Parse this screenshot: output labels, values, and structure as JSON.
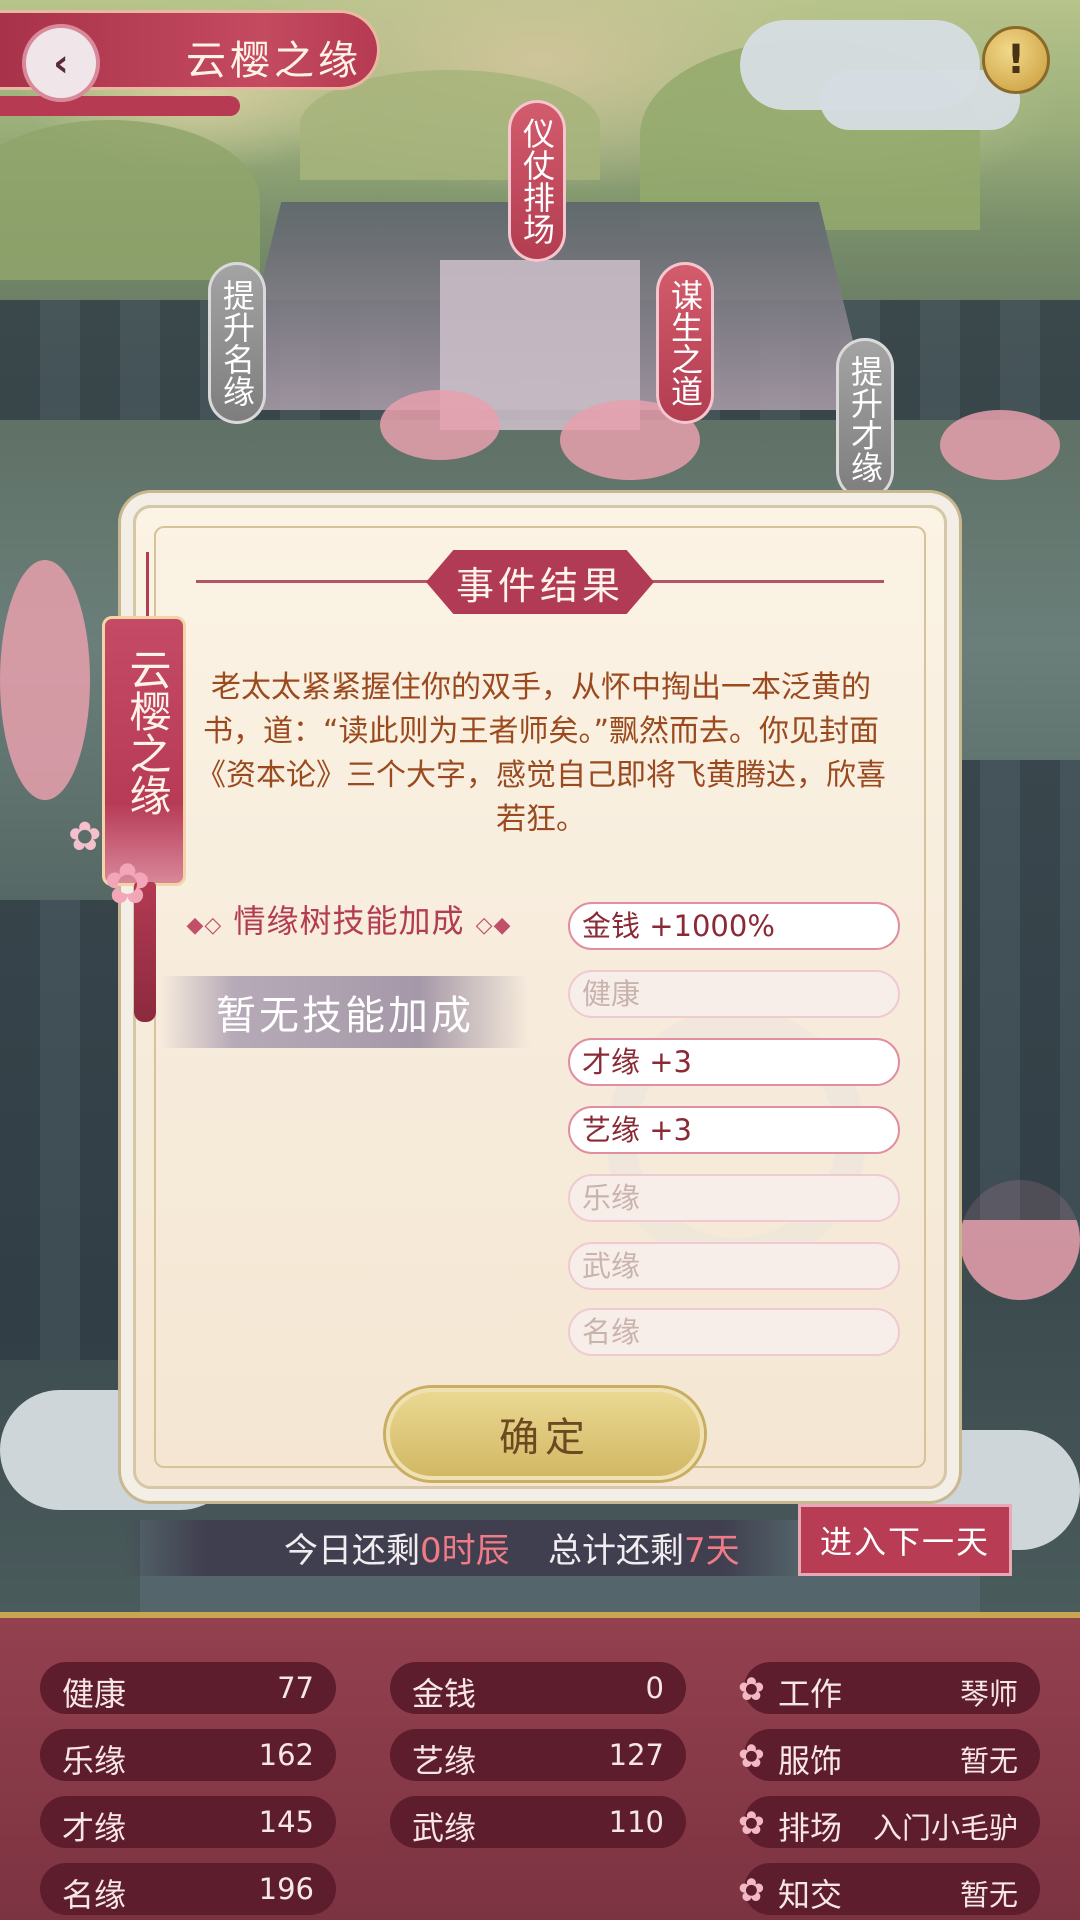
{
  "header": {
    "back_icon": "chevron-left-icon",
    "title": "云樱之缘",
    "info_icon": "exclamation-icon"
  },
  "map_tags": [
    {
      "label": "仪仗排场",
      "style": "red"
    },
    {
      "label": "提升名缘",
      "style": "grey"
    },
    {
      "label": "谋生之道",
      "style": "red"
    },
    {
      "label": "提升才缘",
      "style": "grey"
    }
  ],
  "dialog": {
    "title": "事件结果",
    "side_tag": "云樱之缘",
    "story": "老太太紧紧握住你的双手，从怀中掏出一本泛黄的书，道：“读此则为王者师矣。”飘然而去。你见封面《资本论》三个大字，感觉自己即将飞黄腾达，欣喜若狂。",
    "skill_title": "情缘树技能加成",
    "skill_value": "暂无技能加成",
    "rewards": [
      {
        "text": "金钱 +1000%",
        "active": true
      },
      {
        "text": "健康",
        "active": false
      },
      {
        "text": "才缘 +3",
        "active": true
      },
      {
        "text": "艺缘 +3",
        "active": true
      },
      {
        "text": "乐缘",
        "active": false
      },
      {
        "text": "武缘",
        "active": false
      },
      {
        "text": "名缘",
        "active": false
      }
    ],
    "confirm_label": "确定"
  },
  "day_bar": {
    "today_prefix": "今日还剩",
    "today_value": "0时辰",
    "total_prefix": "总计还剩",
    "total_value": "7天",
    "next_day_label": "进入下一天"
  },
  "stats": {
    "col1": [
      {
        "label": "健康",
        "value": "77"
      },
      {
        "label": "乐缘",
        "value": "162"
      },
      {
        "label": "才缘",
        "value": "145"
      },
      {
        "label": "名缘",
        "value": "196"
      }
    ],
    "col2": [
      {
        "label": "金钱",
        "value": "0"
      },
      {
        "label": "艺缘",
        "value": "127"
      },
      {
        "label": "武缘",
        "value": "110"
      }
    ],
    "col3": [
      {
        "label": "工作",
        "value": "琴师"
      },
      {
        "label": "服饰",
        "value": "暂无"
      },
      {
        "label": "排场",
        "value": "入门小毛驴"
      },
      {
        "label": "知交",
        "value": "暂无"
      }
    ]
  },
  "colors": {
    "accent": "#b13a55",
    "gold": "#d2b864",
    "panel": "#7c3341",
    "highlight": "#f07a86"
  }
}
